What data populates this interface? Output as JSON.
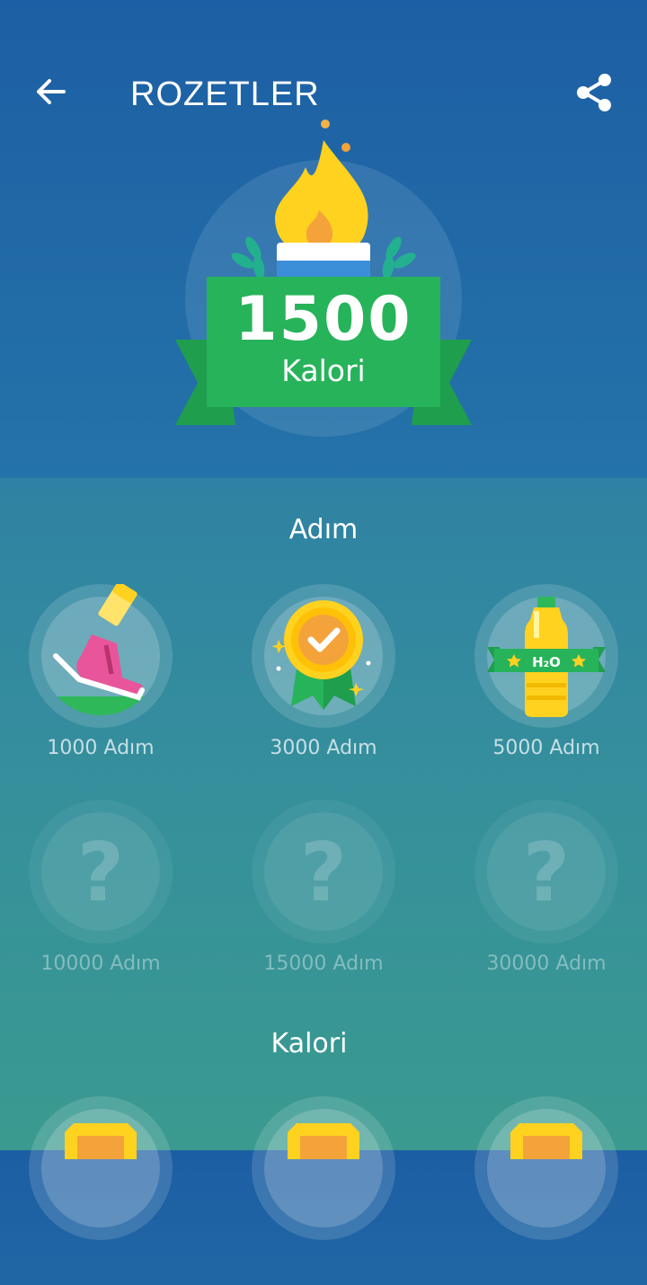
{
  "header": {
    "title": "ROZETLER"
  },
  "hero": {
    "value": "1500",
    "unit": "Kalori"
  },
  "sections": [
    {
      "title": "Adım",
      "badges": [
        {
          "label": "1000 Adım",
          "icon": "shoe-icon",
          "locked": false
        },
        {
          "label": "3000 Adım",
          "icon": "medal-icon",
          "locked": false
        },
        {
          "label": "5000 Adım",
          "icon": "water-bottle-icon",
          "icon_text": "H₂O",
          "locked": false
        },
        {
          "label": "10000 Adım",
          "icon": "question-icon",
          "locked": true
        },
        {
          "label": "15000 Adım",
          "icon": "question-icon",
          "locked": true
        },
        {
          "label": "30000 Adım",
          "icon": "question-icon",
          "locked": true
        }
      ]
    },
    {
      "title": "Kalori"
    }
  ],
  "lock_glyph": "?",
  "colors": {
    "green": "#27b35a",
    "yellow": "#ffd21f",
    "pink": "#e8559a",
    "orange": "#f3a33a",
    "circle": "rgba(255,255,255,0.15)"
  }
}
